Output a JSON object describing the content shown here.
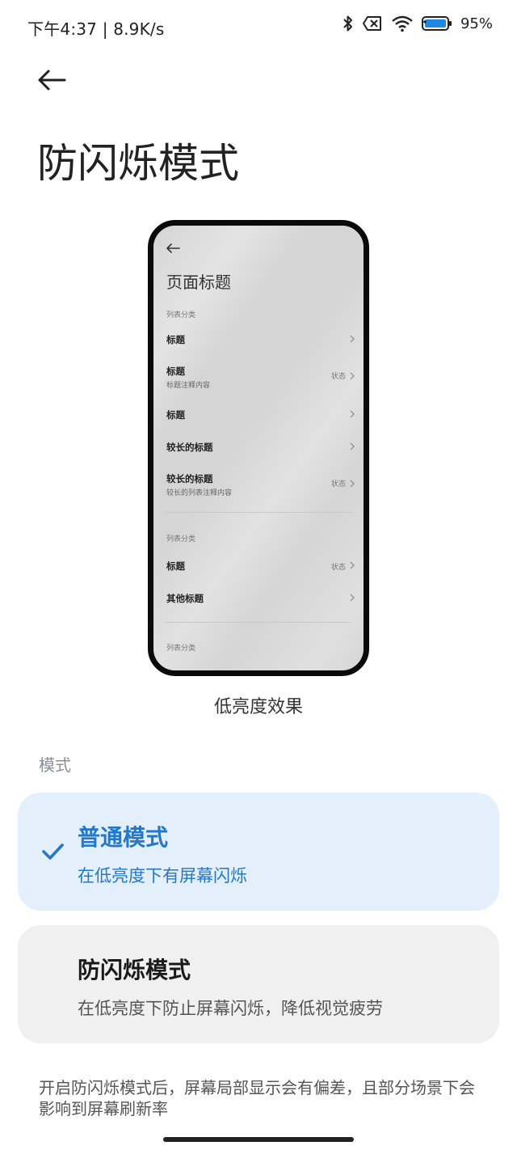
{
  "status_bar": {
    "time": "下午4:37",
    "speed": "8.9K/s",
    "battery": "95%"
  },
  "header": {
    "title": "防闪烁模式"
  },
  "preview": {
    "title": "页面标题",
    "category1": "列表分类",
    "rows1": [
      {
        "title": "标题",
        "subtitle": "",
        "status": ""
      },
      {
        "title": "标题",
        "subtitle": "标题注释内容",
        "status": "状态"
      },
      {
        "title": "标题",
        "subtitle": "",
        "status": ""
      },
      {
        "title": "较长的标题",
        "subtitle": "",
        "status": ""
      },
      {
        "title": "较长的标题",
        "subtitle": "较长的列表注释内容",
        "status": "状态"
      }
    ],
    "category2": "列表分类",
    "rows2": [
      {
        "title": "标题",
        "status": "状态"
      },
      {
        "title": "其他标题",
        "status": ""
      }
    ],
    "category3": "列表分类",
    "caption": "低亮度效果"
  },
  "mode_section": {
    "label": "模式",
    "options": [
      {
        "title": "普通模式",
        "desc": "在低亮度下有屏幕闪烁",
        "selected": true
      },
      {
        "title": "防闪烁模式",
        "desc": "在低亮度下防止屏幕闪烁，降低视觉疲劳",
        "selected": false
      }
    ]
  },
  "footnote": "开启防闪烁模式后，屏幕局部显示会有偏差，且部分场景下会影响到屏幕刷新率",
  "colors": {
    "accent": "#2378c9",
    "selected_bg": "#e3f0fc",
    "unselected_bg": "#f0f0f0"
  }
}
